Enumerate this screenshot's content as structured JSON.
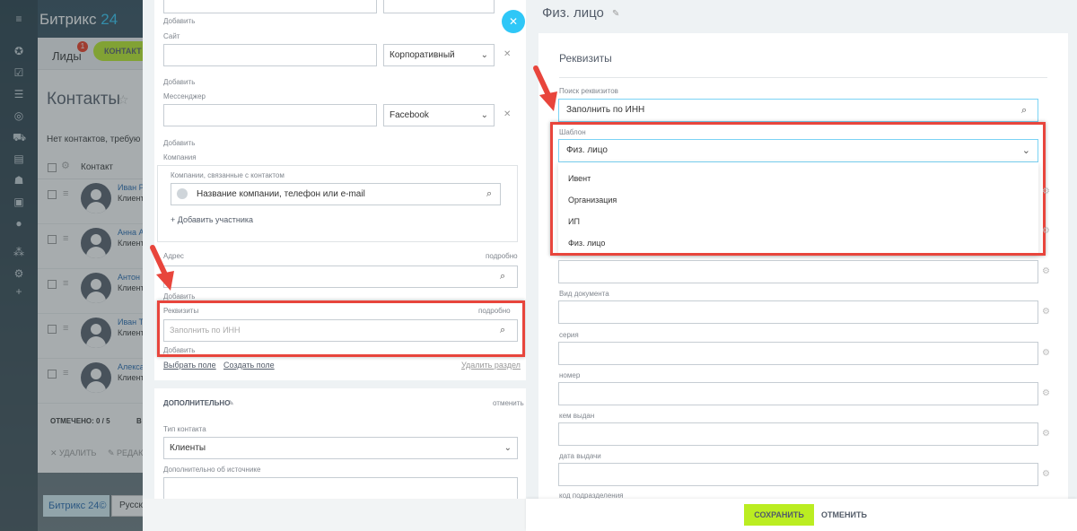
{
  "crm": {
    "logo_text": "Битрикс",
    "logo_num": "24",
    "tab_leads": "Лиды",
    "tab_leads_badge": "1",
    "tab_contact": "КОНТАКТ",
    "title": "Контакты",
    "notice": "Нет контактов, требую",
    "column_contact": "Контакт",
    "rows": [
      {
        "name": "Иван Р",
        "status": "Клиент"
      },
      {
        "name": "Анна А",
        "status": "Клиент"
      },
      {
        "name": "Антон Ч",
        "status": "Клиент"
      },
      {
        "name": "Иван Т",
        "status": "Клиент"
      },
      {
        "name": "Алекса",
        "status": "Клиент"
      }
    ],
    "marked_label": "ОТМЕЧЕНО: 0 / 5",
    "marked_label2": "В",
    "action_delete": "✕ УДАЛИТЬ",
    "action_edit": "✎ РЕДАК",
    "bottom_logo": "Битрикс 24©",
    "bottom_lang": "Русск"
  },
  "middle": {
    "add_1": "Добавить",
    "site_label": "Сайт",
    "site_type": "Корпоративный",
    "add_2": "Добавить",
    "messenger_label": "Мессенджер",
    "messenger_type": "Facebook",
    "add_3": "Добавить",
    "company_label": "Компания",
    "company_sub_label": "Компании, связанные с контактом",
    "company_placeholder": "Название компании, телефон или e-mail",
    "add_participant": "+ Добавить участника",
    "address_label": "Адрес",
    "details_1": "подробно",
    "add_4": "Добавить",
    "requisites_label": "Реквизиты",
    "details_2": "подробно",
    "inn_placeholder": "Заполнить по ИНН",
    "add_5": "Добавить",
    "choose_field": "Выбрать поле",
    "create_field": "Создать поле",
    "delete_section": "Удалить раздел",
    "section_extra": "ДОПОЛНИТЕЛЬНО",
    "section_cancel": "отменить",
    "contact_type_label": "Тип контакта",
    "contact_type_value": "Клиенты",
    "source_extra_label": "Дополнительно об источнике"
  },
  "right": {
    "title": "Физ. лицо",
    "heading": "Реквизиты",
    "search_label": "Поиск реквизитов",
    "search_value": "Заполнить по ИНН",
    "template_label": "Шаблон",
    "template_value": "Физ. лицо",
    "options": [
      "Ивент",
      "Организация",
      "ИП",
      "Физ. лицо"
    ],
    "doc_type_label": "Вид документа",
    "series_label": "серия",
    "number_label": "номер",
    "issued_by_label": "кем выдан",
    "issue_date_label": "дата выдачи",
    "cut_label": "код подразделения",
    "save": "СОХРАНИТЬ",
    "cancel": "ОТМЕНИТЬ"
  },
  "colors": {
    "accent_green": "#bbed21",
    "accent_blue": "#2fc7f7",
    "highlight_red": "#e8453c"
  },
  "icons": [
    "hamburger-icon",
    "search-icon",
    "gear-icon",
    "close-icon",
    "chevron-down-icon",
    "pencil-icon",
    "arrow-icon"
  ]
}
